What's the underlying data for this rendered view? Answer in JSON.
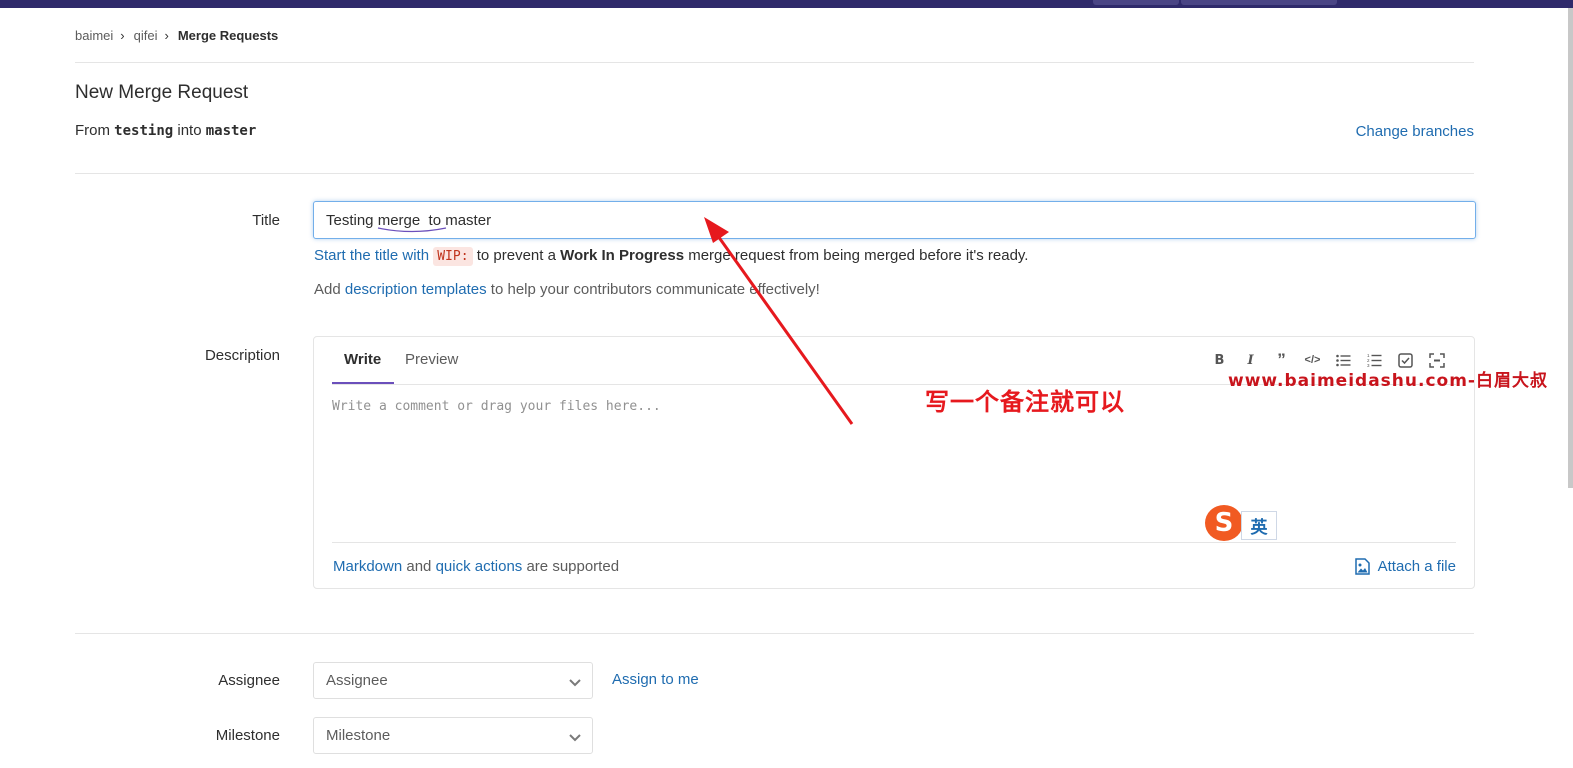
{
  "breadcrumb": {
    "items": [
      "baimei",
      "qifei",
      "Merge Requests"
    ]
  },
  "page": {
    "title": "New Merge Request",
    "from_prefix": "From",
    "source_branch": "testing",
    "into": "into",
    "target_branch": "master",
    "change_branches": "Change branches"
  },
  "form": {
    "title_label": "Title",
    "title_value": "Testing merge  to master",
    "wip_hint": {
      "link": "Start the title with",
      "code": "WIP:",
      "mid": "to prevent a",
      "strong": "Work In Progress",
      "end": "merge request from being merged before it's ready."
    },
    "templates_hint": {
      "prefix": "Add",
      "link": "description templates",
      "suffix": "to help your contributors communicate effectively!"
    },
    "description_label": "Description",
    "tabs": [
      "Write",
      "Preview"
    ],
    "toolbar_icons": [
      "bold-icon",
      "italic-icon",
      "quote-icon",
      "code-icon",
      "bullet-list-icon",
      "numbered-list-icon",
      "task-list-icon",
      "fullscreen-icon"
    ],
    "textarea_placeholder": "Write a comment or drag your files here...",
    "footer": {
      "markdown": "Markdown",
      "and": "and",
      "quick_actions": "quick actions",
      "supported": "are supported"
    },
    "attach": "Attach a file",
    "assignee_label": "Assignee",
    "assignee_placeholder": "Assignee",
    "assign_to_me": "Assign to me",
    "milestone_label": "Milestone",
    "milestone_placeholder": "Milestone"
  },
  "ime": {
    "logo": "S",
    "lang": "英"
  },
  "annotation": {
    "text": "写一个备注就可以",
    "color": "#e6191e"
  },
  "watermark": {
    "text": "www.baimeidashu.com-白眉大叔"
  },
  "colors": {
    "link": "#1f6cb0",
    "accent_tab": "#6b4fbb",
    "topbar": "#2f2a6b"
  }
}
